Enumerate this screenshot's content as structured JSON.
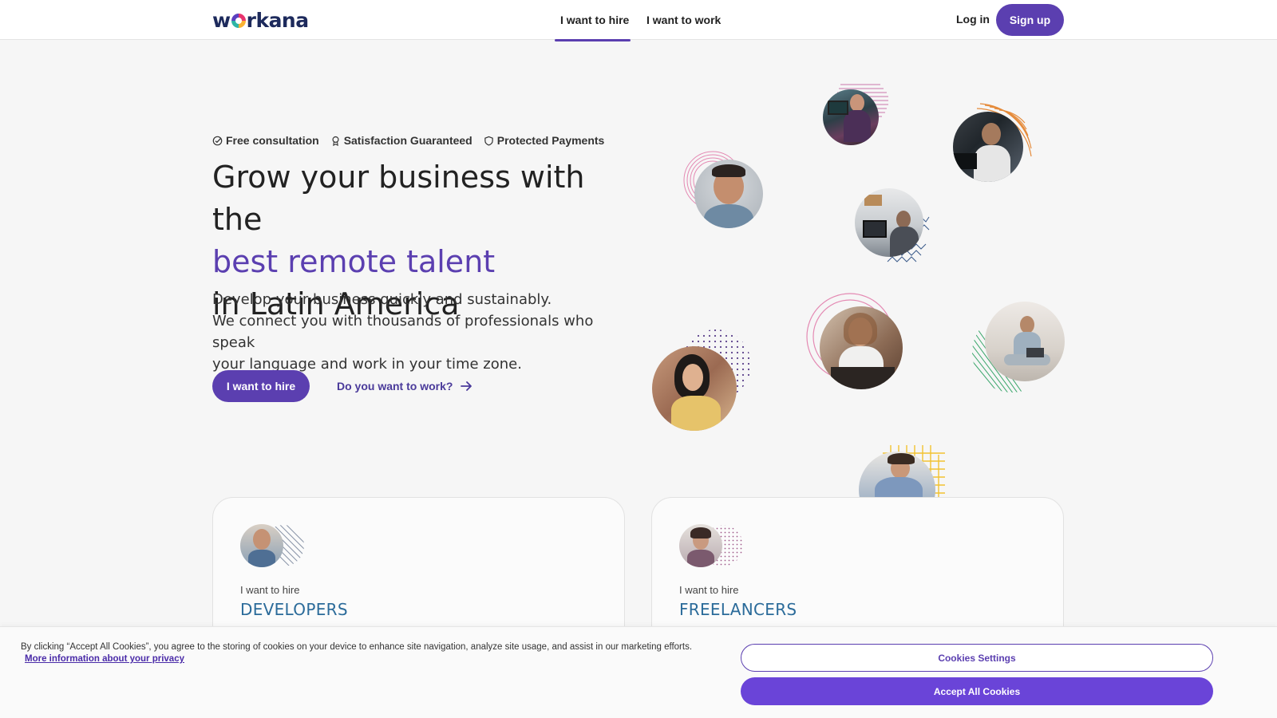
{
  "header": {
    "logo_text_pre": "w",
    "logo_text_post": "rkana",
    "tabs": [
      {
        "label": "I want to hire",
        "active": true
      },
      {
        "label": "I want to work",
        "active": false
      }
    ],
    "login_label": "Log in",
    "signup_label": "Sign up"
  },
  "hero": {
    "badges": [
      {
        "icon": "check-circle-icon",
        "label": "Free consultation"
      },
      {
        "icon": "award-icon",
        "label": "Satisfaction Guaranteed"
      },
      {
        "icon": "shield-icon",
        "label": "Protected Payments"
      }
    ],
    "headline_line1": "Grow your business with the",
    "headline_accent": "best remote talent",
    "headline_line3": "in Latin America",
    "subtext_line1": "Develop your business quickly and sustainably.",
    "subtext_line2": "We connect you with thousands of professionals who speak",
    "subtext_line3": "your language and work in your time zone.",
    "primary_cta": "I want to hire",
    "secondary_cta": "Do you want to work?"
  },
  "cards": [
    {
      "kicker": "I want to hire",
      "title": "DEVELOPERS"
    },
    {
      "kicker": "I want to hire",
      "title": "FREELANCERS"
    }
  ],
  "cookie_banner": {
    "text": "By clicking “Accept All Cookies”, you agree to the storing of cookies on your device to enhance site navigation, analyze site usage, and assist in our marketing efforts.",
    "link": "More information about your privacy",
    "settings_label": "Cookies Settings",
    "accept_label": "Accept All Cookies"
  },
  "colors": {
    "brand_purple": "#5b3fb0",
    "accept_purple": "#6a44d8",
    "card_title_blue": "#2b6b9a",
    "logo_navy": "#1d2a5c"
  }
}
